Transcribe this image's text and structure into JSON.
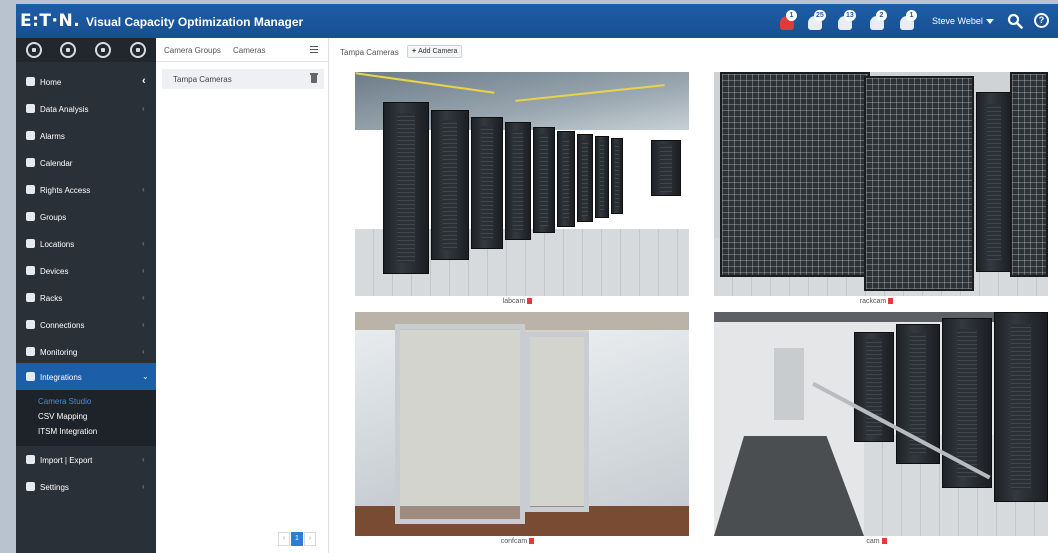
{
  "header": {
    "brand": "E:T·N.",
    "app_title": "Visual Capacity Optimization Manager",
    "notifications": [
      {
        "name": "alarm-critical-icon",
        "count": "1",
        "color": "#e03a3a"
      },
      {
        "name": "alarm-warning-icon",
        "count": "25",
        "color": "#e9eef5"
      },
      {
        "name": "alarm-info-icon",
        "count": "13",
        "color": "#e9eef5"
      },
      {
        "name": "alarm-minor-icon",
        "count": "2",
        "color": "#e9eef5"
      },
      {
        "name": "alarm-notice-icon",
        "count": "1",
        "color": "#e9eef5"
      }
    ],
    "user_name": "Steve Webel",
    "search_icon": "search-icon",
    "help_icon": "?"
  },
  "sidebar": {
    "top_icons": [
      "dashboard-icon",
      "globe-icon",
      "list-icon",
      "star-icon"
    ],
    "items": [
      {
        "label": "Home",
        "icon": "home-icon"
      },
      {
        "label": "Data Analysis",
        "icon": "bar-chart-icon"
      },
      {
        "label": "Alarms",
        "icon": "alarm-icon"
      },
      {
        "label": "Calendar",
        "icon": "calendar-icon"
      },
      {
        "label": "Rights Access",
        "icon": "key-icon"
      },
      {
        "label": "Groups",
        "icon": "groups-icon"
      },
      {
        "label": "Locations",
        "icon": "building-icon"
      },
      {
        "label": "Devices",
        "icon": "device-icon"
      },
      {
        "label": "Racks",
        "icon": "rack-icon"
      },
      {
        "label": "Connections",
        "icon": "connections-icon"
      },
      {
        "label": "Monitoring",
        "icon": "monitoring-icon"
      },
      {
        "label": "Integrations",
        "icon": "integrations-icon"
      },
      {
        "label": "Import | Export",
        "icon": "import-export-icon"
      },
      {
        "label": "Settings",
        "icon": "gear-icon"
      }
    ],
    "submenu": [
      "Camera Studio",
      "CSV Mapping",
      "ITSM Integration"
    ],
    "active_color": "#1d5ea8"
  },
  "groups_panel": {
    "tabs": [
      "Camera Groups",
      "Cameras"
    ],
    "group_name": "Tampa Cameras",
    "pager": {
      "prev": "‹",
      "current": "1",
      "next": "›"
    }
  },
  "main": {
    "breadcrumb": "Tampa Cameras",
    "add_camera": "Add Camera",
    "cameras": [
      {
        "name": "labcam"
      },
      {
        "name": "rackcam"
      },
      {
        "name": "confcam"
      },
      {
        "name": "cam"
      }
    ]
  }
}
